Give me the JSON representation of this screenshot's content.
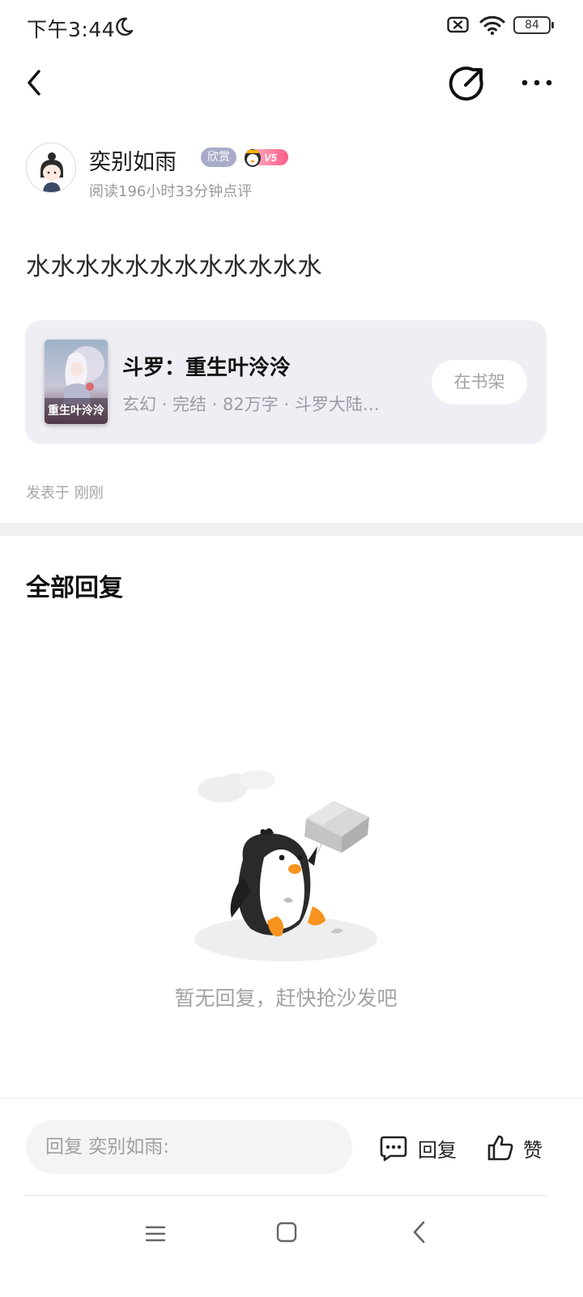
{
  "status_bar": {
    "time": "下午3:44",
    "battery": "84"
  },
  "author": {
    "name": "奕别如雨",
    "badge": "欣赏",
    "vip_level": "V5",
    "meta": "阅读196小时33分钟点评"
  },
  "post": {
    "content": "水水水水水水水水水水水水",
    "time": "发表于 刚刚"
  },
  "book": {
    "title": "斗罗：重生叶泠泠",
    "cover_text": "重生叶泠泠",
    "meta": "玄幻 · 完结 · 82万字 · 斗罗大陆…",
    "shelf_label": "在书架"
  },
  "replies": {
    "title": "全部回复",
    "empty_text": "暂无回复，赶快抢沙发吧"
  },
  "bottom_bar": {
    "input_placeholder": "回复 奕别如雨:",
    "reply_label": "回复",
    "like_label": "赞"
  },
  "colors": {
    "card_bg": "#eeeef4",
    "badge_bg": "#a7abc9",
    "vip_gradient": [
      "#ff9fb3",
      "#ff5c8a"
    ],
    "penguin_beak": "#f7931e"
  },
  "icons": [
    "moon-icon",
    "signal-icon",
    "wifi-icon",
    "battery-icon",
    "back-icon",
    "share-icon",
    "more-icon",
    "comment-icon",
    "thumbs-up-icon",
    "nav-menu-icon",
    "nav-home-icon",
    "nav-back-icon"
  ]
}
